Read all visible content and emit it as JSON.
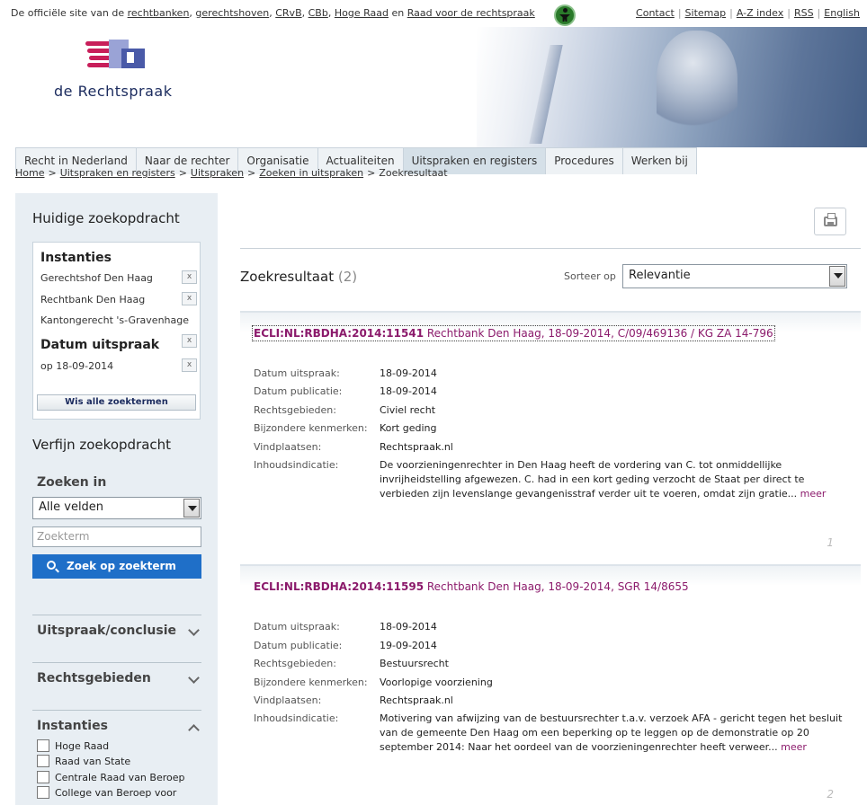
{
  "topbar": {
    "official_prefix": "De officiële site van de",
    "links": [
      "rechtbanken",
      "gerechtshoven",
      "CRvB",
      "CBb",
      "Hoge Raad"
    ],
    "and_word": "en",
    "last_link": "Raad voor de rechtspraak",
    "right_links": [
      "Contact",
      "Sitemap",
      "A-Z index",
      "RSS",
      "English"
    ]
  },
  "header": {
    "logo_text": "de Rechtspraak"
  },
  "nav": {
    "tabs": [
      "Recht in Nederland",
      "Naar de rechter",
      "Organisatie",
      "Actualiteiten",
      "Uitspraken en registers",
      "Procedures",
      "Werken bij"
    ],
    "active_index": 4
  },
  "breadcrumb": {
    "items": [
      "Home",
      "Uitspraken en registers",
      "Uitspraken",
      "Zoeken in uitspraken"
    ],
    "current": "Zoekresultaat",
    "sep": ">"
  },
  "sidebar": {
    "current_title": "Huidige zoekopdracht",
    "instanties_heading": "Instanties",
    "instanties": [
      "Gerechtshof Den Haag",
      "Rechtbank Den Haag",
      "Kantongerecht 's-Gravenhage"
    ],
    "datum_heading": "Datum uitspraak",
    "datum_value": "op 18-09-2014",
    "remove_glyph": "x",
    "clear_label": "Wis alle zoektermen",
    "refine_title": "Verfijn zoekopdracht",
    "search_in_label": "Zoeken in",
    "search_in_value": "Alle velden",
    "search_placeholder": "Zoekterm",
    "search_button": "Zoek op zoekterm",
    "facets": [
      "Uitspraak/conclusie",
      "Rechtsgebieden",
      "Instanties"
    ],
    "instantie_options": [
      "Hoge Raad",
      "Raad van State",
      "Centrale Raad van Beroep",
      "College van Beroep voor"
    ]
  },
  "main": {
    "results_label": "Zoekresultaat",
    "results_count": "(2)",
    "sort_label": "Sorteer op",
    "sort_value": "Relevantie"
  },
  "results": [
    {
      "ecli": "ECLI:NL:RBDHA:2014:11541",
      "title_rest": "Rechtbank Den Haag, 18-09-2014, C/09/469136 / KG ZA 14-796",
      "fields": [
        [
          "Datum uitspraak:",
          "18-09-2014"
        ],
        [
          "Datum publicatie:",
          "18-09-2014"
        ],
        [
          "Rechtsgebieden:",
          "Civiel recht"
        ],
        [
          "Bijzondere kenmerken:",
          "Kort geding"
        ],
        [
          "Vindplaatsen:",
          "Rechtspraak.nl"
        ]
      ],
      "summary_label": "Inhoudsindicatie:",
      "summary": "De voorzieningenrechter in Den Haag heeft de vordering van C. tot onmiddellijke invrijheidstelling afgewezen. C. had in een kort geding verzocht de Staat per direct te verbieden zijn levenslange gevangenisstraf verder uit te voeren, omdat zijn gratie...",
      "more": "meer",
      "index": "1"
    },
    {
      "ecli": "ECLI:NL:RBDHA:2014:11595",
      "title_rest": "Rechtbank Den Haag, 18-09-2014, SGR 14/8655",
      "fields": [
        [
          "Datum uitspraak:",
          "18-09-2014"
        ],
        [
          "Datum publicatie:",
          "19-09-2014"
        ],
        [
          "Rechtsgebieden:",
          "Bestuursrecht"
        ],
        [
          "Bijzondere kenmerken:",
          "Voorlopige voorziening"
        ],
        [
          "Vindplaatsen:",
          "Rechtspraak.nl"
        ]
      ],
      "summary_label": "Inhoudsindicatie:",
      "summary": "Motivering van afwijzing van de bestuursrechter t.a.v. verzoek AFA - gericht tegen het besluit van de gemeente Den Haag om een beperking op te leggen op de demonstratie op 20 september 2014: Naar het oordeel van de voorzieningenrechter heeft verweer...",
      "more": "meer",
      "index": "2"
    }
  ]
}
